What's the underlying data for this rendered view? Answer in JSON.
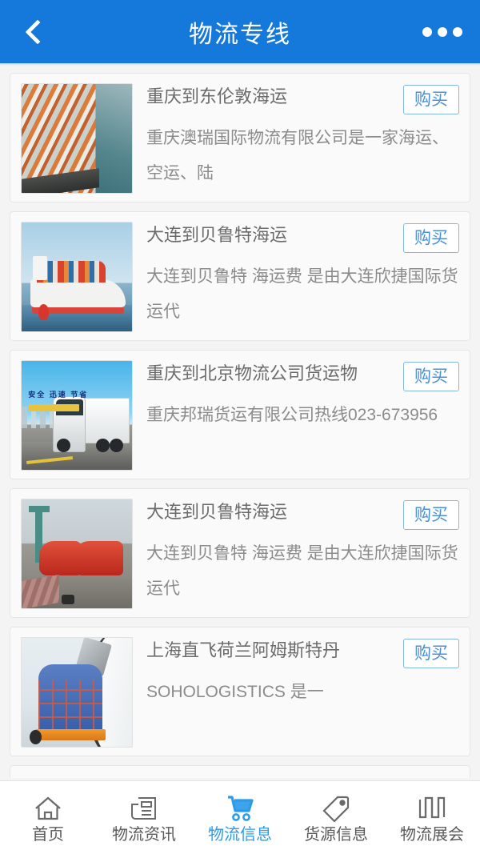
{
  "header": {
    "title": "物流专线",
    "back_icon": "chevron-left-icon",
    "menu_icon": "more-dots-icon"
  },
  "list": {
    "items": [
      {
        "title": "重庆到东伦敦海运",
        "desc": "重庆澳瑞国际物流有限公司是一家海运、空运、陆",
        "buy_label": "购买",
        "thumb": "container-port-photo"
      },
      {
        "title": "大连到贝鲁特海运",
        "desc": "大连到贝鲁特 海运费 是由大连欣捷国际货运代",
        "buy_label": "购买",
        "thumb": "container-ship-photo"
      },
      {
        "title": "重庆到北京物流公司货运物",
        "desc": "重庆邦瑞货运有限公司热线023-673956",
        "buy_label": "购买",
        "thumb": "freight-truck-photo",
        "thumb_slogan": "安全 迅速 节省"
      },
      {
        "title": "大连到贝鲁特海运",
        "desc": "大连到贝鲁特 海运费 是由大连欣捷国际货运代",
        "buy_label": "购买",
        "thumb": "red-cargo-ships-photo"
      },
      {
        "title": "上海直飞荷兰阿姆斯特丹",
        "desc": "SOHOLOGISTICS 是一",
        "buy_label": "购买",
        "thumb": "air-cargo-pallet-photo"
      }
    ]
  },
  "tabbar": {
    "items": [
      {
        "label": "首页",
        "icon": "home-icon",
        "active": false
      },
      {
        "label": "物流资讯",
        "icon": "newspaper-icon",
        "active": false
      },
      {
        "label": "物流信息",
        "icon": "shopping-cart-icon",
        "active": true
      },
      {
        "label": "货源信息",
        "icon": "tag-icon",
        "active": false
      },
      {
        "label": "物流展会",
        "icon": "folded-map-icon",
        "active": false
      }
    ]
  },
  "colors": {
    "header_blue": "#1579dc",
    "accent_blue": "#2b9bea",
    "buy_border": "#83b6e4",
    "buy_text": "#4a90d9",
    "title_text": "#6b6b6b",
    "desc_text": "#8b8b8b",
    "page_bg": "#f4f4f4",
    "card_bg": "#fafafa"
  }
}
